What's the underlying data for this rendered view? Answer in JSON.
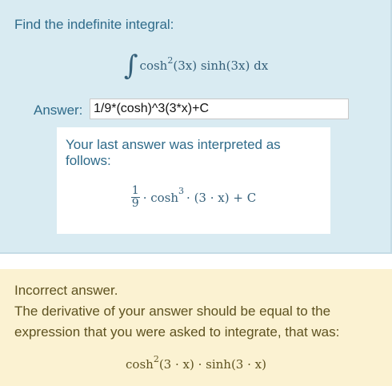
{
  "question": {
    "prompt": "Find the indefinite integral:",
    "integral": {
      "sign": "∫",
      "func1": "cosh",
      "exp": "2",
      "arg1": "(3x) sinh(3x) dx"
    }
  },
  "answer": {
    "label": "Answer:",
    "value": "1/9*(cosh)^3(3*x)+C"
  },
  "interpretation": {
    "heading": "Your last answer was interpreted as follows:",
    "frac_num": "1",
    "frac_den": "9",
    "mid1": "· cosh",
    "exp": "3",
    "rest": "· (3 · x) + C"
  },
  "feedback": {
    "status": "Incorrect answer.",
    "line1": "The derivative of your answer should be equal to the",
    "line2": "expression that you were asked to integrate, that was:",
    "expr_func": "cosh",
    "expr_exp": "2",
    "expr_rest": "(3 · x) · sinh(3 · x)"
  },
  "colors": {
    "question_bg": "#d9ebf2",
    "feedback_bg": "#fbf2d2",
    "text_blue": "#2f6b8a",
    "text_brown": "#5e5220"
  }
}
